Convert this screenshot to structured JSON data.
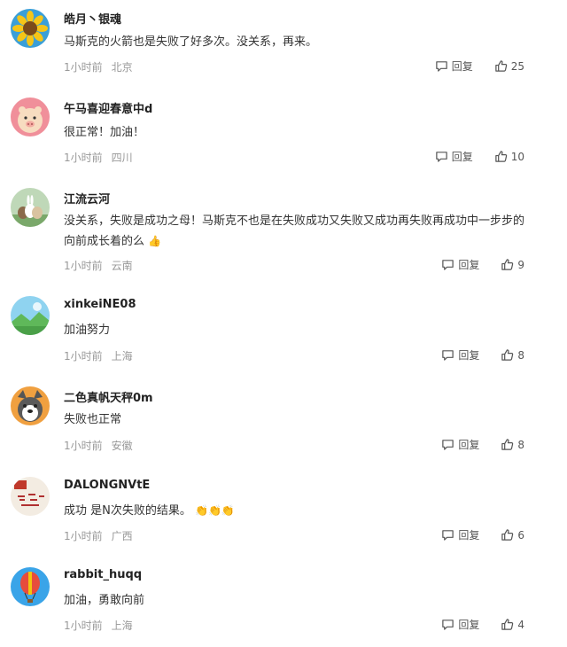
{
  "comments": [
    {
      "user": "皓月丶银魂",
      "text": "马斯克的火箭也是失败了好多次。没关系，再来。",
      "time": "1小时前",
      "location": "北京",
      "reply_label": "回复",
      "likes": "25",
      "emoji": ""
    },
    {
      "user": "午马喜迎春意中d",
      "text": "很正常！加油！",
      "time": "1小时前",
      "location": "四川",
      "reply_label": "回复",
      "likes": "10",
      "emoji": ""
    },
    {
      "user": "江流云河",
      "text": "没关系，失败是成功之母！马斯克不也是在失败成功又失败又成功再失败再成功中一步步的向前成长着的么",
      "time": "1小时前",
      "location": "云南",
      "reply_label": "回复",
      "likes": "9",
      "emoji": "👍"
    },
    {
      "user": "xinkeiNE08",
      "text": "加油努力",
      "time": "1小时前",
      "location": "上海",
      "reply_label": "回复",
      "likes": "8",
      "emoji": ""
    },
    {
      "user": "二色真帆天秤0m",
      "text": "失败也正常",
      "time": "1小时前",
      "location": "安徽",
      "reply_label": "回复",
      "likes": "8",
      "emoji": ""
    },
    {
      "user": "DALONGNVtE",
      "text": "成功 是N次失败的结果。",
      "time": "1小时前",
      "location": "广西",
      "reply_label": "回复",
      "likes": "6",
      "emoji": "👏👏👏"
    },
    {
      "user": "rabbit_huqq",
      "text": "加油，勇敢向前",
      "time": "1小时前",
      "location": "上海",
      "reply_label": "回复",
      "likes": "4",
      "emoji": ""
    }
  ]
}
